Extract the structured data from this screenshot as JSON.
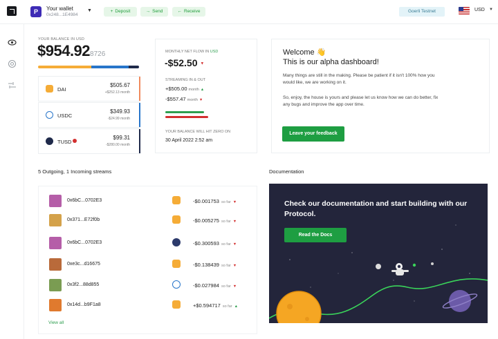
{
  "header": {
    "wallet_avatar": "P",
    "wallet_name": "Your wallet",
    "wallet_address": "0x248...1E4984",
    "deposit_label": "Deposit",
    "send_label": "Send",
    "receive_label": "Receive",
    "network_label": "Goerli Testnet",
    "currency_label": "USD",
    "accent_green": "#1e9e42"
  },
  "balance": {
    "label": "YOUR BALANCE IN USD",
    "amount_main": "$954.92",
    "amount_fraction": "8726",
    "tokens": [
      {
        "name": "DAI",
        "value": "$505.67",
        "sub": "+$252.13 month",
        "color": "#f5ac37"
      },
      {
        "name": "USDC",
        "value": "$349.93",
        "sub": "-$24.99 month",
        "color": "#2775ca"
      },
      {
        "name": "TUSD",
        "value": "$99.31",
        "sub": "-$280.00 month",
        "color": "#1a5aff"
      }
    ]
  },
  "flow": {
    "label_prefix": "MONTHLY NET FLOW IN",
    "label_currency": "USD",
    "net": "-$52.50",
    "streaming_label": "STREAMING IN & OUT",
    "in_amount": "+$505.00",
    "in_period": "month",
    "out_amount": "-$557.47",
    "out_period": "month",
    "zero_label": "YOUR BALANCE WILL HIT ZERO ON",
    "zero_date": "30 April 2022 2:52 am"
  },
  "welcome": {
    "title": "Welcome 👋",
    "subtitle": "This is our alpha dashboard!",
    "para1": "Many things are still in the making. Please be patient if it isn't 100% how you would like, we are working on it.",
    "para2": "So, enjoy, the house is yours and please let us know how we can do better, fix any bugs and improve the app over time.",
    "feedback_label": "Leave your feedback"
  },
  "streams": {
    "title": "5 Outgoing, 1 Incoming streams",
    "so_far": "so far",
    "view_all": "View all",
    "rows": [
      {
        "address": "0x6bC...0702E3",
        "amount": "-$0.001753",
        "direction": "out",
        "avatar_color": "#b55ea8",
        "token_color": "#f5ac37"
      },
      {
        "address": "0x371...E72f0b",
        "amount": "-$0.005275",
        "direction": "out",
        "avatar_color": "#d4a24a",
        "token_color": "#f5ac37"
      },
      {
        "address": "0x6bC...0702E3",
        "amount": "-$0.300593",
        "direction": "out",
        "avatar_color": "#b55ea8",
        "token_color": "#2c3a6b"
      },
      {
        "address": "0xe3c...d16675",
        "amount": "-$0.138439",
        "direction": "out",
        "avatar_color": "#b96a3a",
        "token_color": "#f5ac37"
      },
      {
        "address": "0x3f2...88d855",
        "amount": "-$0.027984",
        "direction": "out",
        "avatar_color": "#7a9c52",
        "token_color": "#2775ca"
      },
      {
        "address": "0x14d...b9F1a8",
        "amount": "+$0.594717",
        "direction": "in",
        "avatar_color": "#e07a2e",
        "token_color": "#f5ac37"
      }
    ]
  },
  "docs": {
    "title": "Documentation",
    "headline": "Check our documentation and start building with our Protocol.",
    "button_label": "Read the Docs"
  }
}
